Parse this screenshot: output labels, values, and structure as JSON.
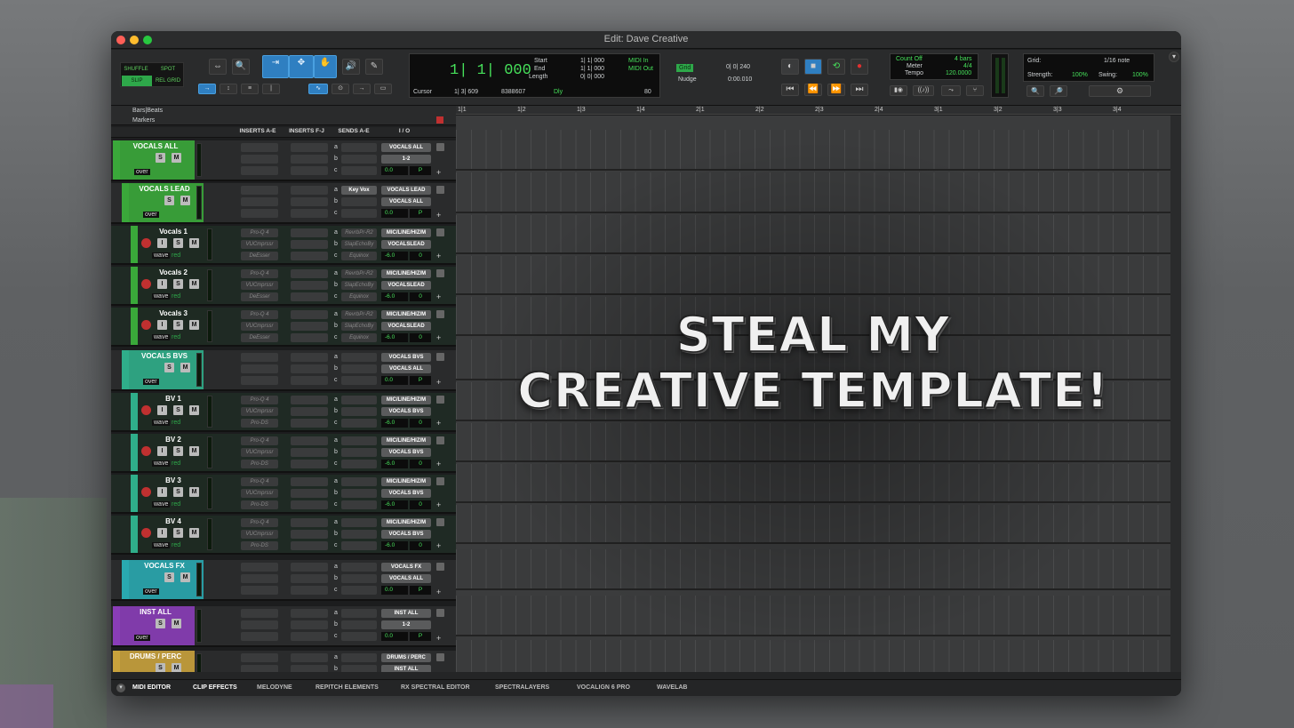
{
  "window": {
    "title": "Edit: Dave Creative"
  },
  "edit_modes": {
    "shuffle": "SHUFFLE",
    "spot": "SPOT",
    "slip": "SLIP",
    "rel_grid": "REL GRID"
  },
  "counter": {
    "main": "1| 1| 000",
    "start_label": "Start",
    "end_label": "End",
    "length_label": "Length",
    "start": "1| 1| 000",
    "end": "1| 1| 000",
    "length": "0| 0| 000",
    "cursor_label": "Cursor",
    "cursor_value": "1| 3| 609",
    "sample_value": "8388607",
    "dly_label": "Dly",
    "midi_in": "MIDI In",
    "midi_out": "MIDI Out",
    "tempo_value": "80"
  },
  "grid": {
    "grid_label": "Grid",
    "grid_value": "0| 0| 240",
    "nudge_label": "Nudge",
    "nudge_value": "0:00.010"
  },
  "meter_panel": {
    "count_off": "Count Off",
    "bars": "4 bars",
    "meter_label": "Meter",
    "meter_value": "4/4",
    "tempo_label": "Tempo",
    "tempo_value": "120.0000"
  },
  "grid_panel": {
    "grid_label": "Grid:",
    "grid_value": "1/16 note",
    "strength_label": "Strength:",
    "strength_value": "100%",
    "swing_label": "Swing:",
    "swing_value": "100%"
  },
  "ruler": {
    "label": "Bars|Beats",
    "markers_label": "Markers",
    "ticks": [
      "1|1",
      "1|2",
      "1|3",
      "1|4",
      "2|1",
      "2|2",
      "2|3",
      "2|4",
      "3|1",
      "3|2",
      "3|3",
      "3|4"
    ]
  },
  "columns": {
    "inserts_ae": "INSERTS A-E",
    "inserts_fj": "INSERTS F-J",
    "sends_ae": "SENDS A-E",
    "io": "I / O"
  },
  "tracks": [
    {
      "name": "VOCALS ALL",
      "color": "#3aa83a",
      "kind": "aux",
      "io_in": "VOCALS ALL",
      "io_out": "1-2",
      "vol": "0.0",
      "mode": "over",
      "sends": [
        "a",
        "b",
        "c"
      ],
      "inserts": [],
      "send_names": []
    },
    {
      "name": "VOCALS LEAD",
      "color": "#3aa83a",
      "kind": "aux",
      "io_in": "VOCALS LEAD",
      "io_out": "VOCALS ALL",
      "vol": "0.0",
      "mode": "over",
      "sends": [
        "a",
        "b",
        "c"
      ],
      "inserts": [],
      "send_names": [
        "Key Vox"
      ]
    },
    {
      "name": "Vocals 1",
      "color": "#3aa83a",
      "kind": "audio",
      "io_in": "MIC/LINE/HIZ/M",
      "io_out": "VOCALSLEAD",
      "vol": "-6.0",
      "pan": "0",
      "mode": "wave",
      "rec": "red",
      "sends": [
        "a",
        "b",
        "c"
      ],
      "inserts": [
        "Pro-Q 4",
        "VUCmprssr",
        "DeEsser"
      ],
      "send_names": [
        "RevrbPr-R2",
        "SlapEchoBy",
        "Equinox"
      ]
    },
    {
      "name": "Vocals 2",
      "color": "#3aa83a",
      "kind": "audio",
      "io_in": "MIC/LINE/HIZ/M",
      "io_out": "VOCALSLEAD",
      "vol": "-6.0",
      "pan": "0",
      "mode": "wave",
      "rec": "red",
      "sends": [
        "a",
        "b",
        "c"
      ],
      "inserts": [
        "Pro-Q 4",
        "VUCmprssr",
        "DeEsser"
      ],
      "send_names": [
        "RevrbPr-R2",
        "SlapEchoBy",
        "Equinox"
      ]
    },
    {
      "name": "Vocals 3",
      "color": "#3aa83a",
      "kind": "audio",
      "io_in": "MIC/LINE/HIZ/M",
      "io_out": "VOCALSLEAD",
      "vol": "-6.0",
      "pan": "0",
      "mode": "wave",
      "rec": "red",
      "sends": [
        "a",
        "b",
        "c"
      ],
      "inserts": [
        "Pro-Q 4",
        "VUCmprssr",
        "DeEsser"
      ],
      "send_names": [
        "RevrbPr-R2",
        "SlapEchoBy",
        "Equinox"
      ]
    },
    {
      "name": "VOCALS BVS",
      "color": "#2fae8a",
      "kind": "aux",
      "io_in": "VOCALS BVS",
      "io_out": "VOCALS ALL",
      "vol": "0.0",
      "mode": "over",
      "sends": [
        "a",
        "b",
        "c"
      ],
      "inserts": [],
      "send_names": []
    },
    {
      "name": "BV 1",
      "color": "#2fae8a",
      "kind": "audio",
      "io_in": "MIC/LINE/HIZ/M",
      "io_out": "VOCALS BVS",
      "vol": "-6.0",
      "pan": "0",
      "mode": "wave",
      "rec": "red",
      "sends": [
        "a",
        "b",
        "c"
      ],
      "inserts": [
        "Pro-Q 4",
        "VUCmprssr",
        "Pro-DS"
      ],
      "send_names": []
    },
    {
      "name": "BV 2",
      "color": "#2fae8a",
      "kind": "audio",
      "io_in": "MIC/LINE/HIZ/M",
      "io_out": "VOCALS BVS",
      "vol": "-6.0",
      "pan": "0",
      "mode": "wave",
      "rec": "red",
      "sends": [
        "a",
        "b",
        "c"
      ],
      "inserts": [
        "Pro-Q 4",
        "VUCmprssr",
        "Pro-DS"
      ],
      "send_names": []
    },
    {
      "name": "BV 3",
      "color": "#2fae8a",
      "kind": "audio",
      "io_in": "MIC/LINE/HIZ/M",
      "io_out": "VOCALS BVS",
      "vol": "-6.0",
      "pan": "0",
      "mode": "wave",
      "rec": "red",
      "sends": [
        "a",
        "b",
        "c"
      ],
      "inserts": [
        "Pro-Q 4",
        "VUCmprssr",
        "Pro-DS"
      ],
      "send_names": []
    },
    {
      "name": "BV 4",
      "color": "#2fae8a",
      "kind": "audio",
      "io_in": "MIC/LINE/HIZ/M",
      "io_out": "VOCALS BVS",
      "vol": "-6.0",
      "pan": "0",
      "mode": "wave",
      "rec": "red",
      "sends": [
        "a",
        "b",
        "c"
      ],
      "inserts": [
        "Pro-Q 4",
        "VUCmprssr",
        "Pro-DS"
      ],
      "send_names": []
    },
    {
      "name": "VOCALS FX",
      "color": "#29a9b0",
      "kind": "aux",
      "io_in": "VOCALS FX",
      "io_out": "VOCALS ALL",
      "vol": "0.0",
      "mode": "over",
      "sends": [
        "a",
        "b",
        "c"
      ],
      "inserts": [],
      "send_names": []
    },
    {
      "name": "INST ALL",
      "color": "#8a3db8",
      "kind": "aux",
      "io_in": "INST ALL",
      "io_out": "1-2",
      "vol": "0.0",
      "mode": "over",
      "sends": [
        "a",
        "b",
        "c"
      ],
      "inserts": [],
      "send_names": []
    },
    {
      "name": "DRUMS / PERC",
      "color": "#c9a23c",
      "kind": "aux",
      "io_in": "DRUMS / PERC",
      "io_out": "INST ALL",
      "vol": "",
      "mode": "",
      "sends": [
        "a",
        "b"
      ],
      "inserts": [],
      "send_names": []
    }
  ],
  "overlay": {
    "line1": "STEAL MY",
    "line2": "CREATIVE TEMPLATE!"
  },
  "bottom_tabs": [
    "MIDI EDITOR",
    "CLIP EFFECTS",
    "MELODYNE",
    "REPITCH ELEMENTS",
    "RX SPECTRAL EDITOR",
    "SPECTRALAYERS",
    "VOCALIGN 6 PRO",
    "WAVELAB"
  ]
}
